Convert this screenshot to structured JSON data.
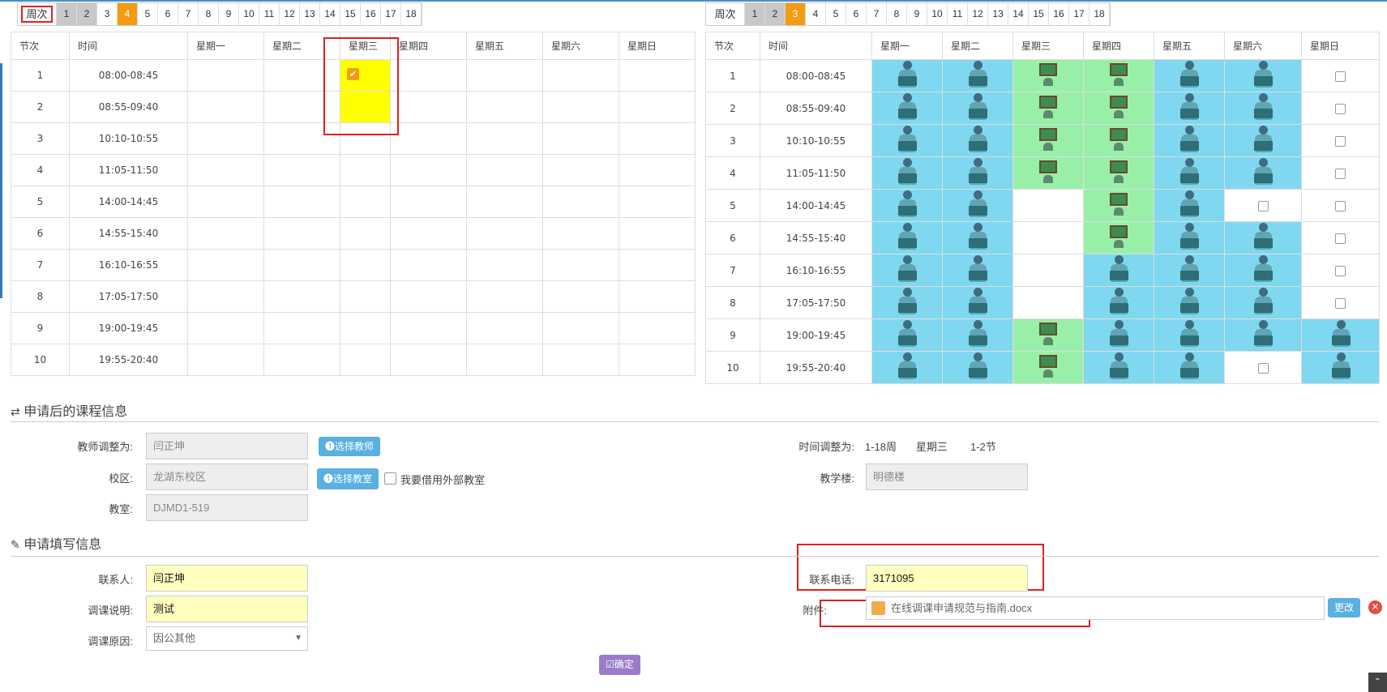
{
  "left_panel": {
    "week_label": "周次",
    "weeks": [
      "1",
      "2",
      "3",
      "4",
      "5",
      "6",
      "7",
      "8",
      "9",
      "10",
      "11",
      "12",
      "13",
      "14",
      "15",
      "16",
      "17",
      "18"
    ],
    "selected_week": "4",
    "columns": [
      "节次",
      "时间",
      "星期一",
      "星期二",
      "星期三",
      "星期四",
      "星期五",
      "星期六",
      "星期日"
    ],
    "periods": [
      "1",
      "2",
      "3",
      "4",
      "5",
      "6",
      "7",
      "8",
      "9",
      "10"
    ],
    "times": [
      "08:00-08:45",
      "08:55-09:40",
      "10:10-10:55",
      "11:05-11:50",
      "14:00-14:45",
      "14:55-15:40",
      "16:10-16:55",
      "17:05-17:50",
      "19:00-19:45",
      "19:55-20:40"
    ]
  },
  "right_panel": {
    "week_label": "周次",
    "weeks": [
      "1",
      "2",
      "3",
      "4",
      "5",
      "6",
      "7",
      "8",
      "9",
      "10",
      "11",
      "12",
      "13",
      "14",
      "15",
      "16",
      "17",
      "18"
    ],
    "selected_week": "3",
    "columns": [
      "节次",
      "时间",
      "星期一",
      "星期二",
      "星期三",
      "星期四",
      "星期五",
      "星期六",
      "星期日"
    ],
    "periods": [
      "1",
      "2",
      "3",
      "4",
      "5",
      "6",
      "7",
      "8",
      "9",
      "10"
    ],
    "times": [
      "08:00-08:45",
      "08:55-09:40",
      "10:10-10:55",
      "11:05-11:50",
      "14:00-14:45",
      "14:55-15:40",
      "16:10-16:55",
      "17:05-17:50",
      "19:00-19:45",
      "19:55-20:40"
    ]
  },
  "course_info": {
    "section_icon": "exchange-icon",
    "title": "申请后的课程信息",
    "teacher_label": "教师调整为:",
    "teacher_value": "闫正坤",
    "select_teacher": "选择教师",
    "campus_label": "校区:",
    "campus_value": "龙湖东校区",
    "select_room": "选择教室",
    "external_room": "我要借用外部教室",
    "room_label": "教室:",
    "room_value": "DJMD1-519",
    "time_label": "时间调整为:",
    "time_weeks": "1-18周",
    "time_day": "星期三",
    "time_periods": "1-2节",
    "building_label": "教学楼:",
    "building_value": "明德楼"
  },
  "apply_info": {
    "section_icon": "edit-icon",
    "title": "申请填写信息",
    "contact_label": "联系人:",
    "contact_value": "闫正坤",
    "note_label": "调课说明:",
    "note_value": "测试",
    "reason_label": "调课原因:",
    "reason_value": "因公其他",
    "phone_label": "联系电话:",
    "phone_value": "3171095",
    "attach_label": "附件:",
    "attach_value": "在线调课申请规范与指南.docx",
    "change_btn": "更改",
    "confirm_btn": "确定"
  },
  "colors": {
    "cyan": "#7fd7f0",
    "green": "#98f0a8",
    "yellow": "#ffff00",
    "orange": "#f39c12",
    "red": "#e02020"
  }
}
